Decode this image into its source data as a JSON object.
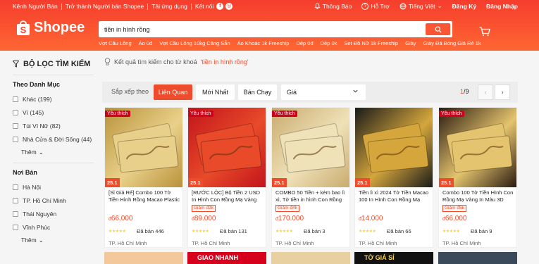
{
  "topbar": {
    "left": [
      "Kênh Người Bán",
      "Trở thành Người bán Shopee",
      "Tải ứng dụng",
      "Kết nối"
    ],
    "notifications": "Thông Báo",
    "help": "Hỗ Trợ",
    "language": "Tiếng Việt",
    "register": "Đăng Ký",
    "login": "Đăng Nhập"
  },
  "logo": {
    "text": "Shopee"
  },
  "search": {
    "query": "tiền in hình rồng",
    "suggestions": [
      "Vợt Cầu Lông",
      "Áo 0đ",
      "Vợt Cầu Lông 10kg Căng Sẵn",
      "Áo Khoác 1k Freeship",
      "Dép 0đ",
      "Dép 0k",
      "Set Đồ Nữ 1k Freeship",
      "Giày",
      "Giày Đá Bóng Giá Rẻ 1k"
    ]
  },
  "sidebar": {
    "title": "BỘ LỌC TÌM KIẾM",
    "category_title": "Theo Danh Mục",
    "categories": [
      "Khác (199)",
      "Ví (145)",
      "Túi Ví Nữ (82)",
      "Nhà Cửa & Đời Sống (44)"
    ],
    "more": "Thêm",
    "location_title": "Nơi Bán",
    "locations": [
      "Hà Nội",
      "TP. Hồ Chí Minh",
      "Thái Nguyên",
      "Vĩnh Phúc"
    ],
    "more2": "Thêm"
  },
  "result": {
    "prefix": "Kết quả tìm kiếm cho từ khoá",
    "keyword": "'tiền in hình rồng'"
  },
  "sort": {
    "label": "Sắp xếp theo",
    "relevant": "Liên Quan",
    "newest": "Mới Nhất",
    "top_sales": "Bán Chạy",
    "price": "Giá",
    "page_current": "1",
    "page_total": "/9"
  },
  "products": [
    {
      "badge": "Yêu thích",
      "sale": "25.1",
      "title": "[Sỉ Giá Rẻ] Combo 100 Tờ Tiền Hình Rồng Macao Plastic Mạ...",
      "discount": "",
      "currency": "đ",
      "price": "66.000",
      "sold": "Đã bán 446",
      "location": "TP. Hồ Chí Minh",
      "bg1": "#b8923a",
      "bg2": "#e9d08a"
    },
    {
      "badge": "Yêu thích",
      "sale": "25.1",
      "title": "[RƯỚC LỘC] Bộ Tiền 2 USD In Hình Con Rồng Mạ Vàng Mừ...",
      "discount": "Giảm đ2k",
      "currency": "đ",
      "price": "89.000",
      "sold": "Đã bán 131",
      "location": "TP. Hồ Chí Minh",
      "bg1": "#c2141b",
      "bg2": "#e84a2a"
    },
    {
      "badge": "Yêu thích",
      "sale": "25.1",
      "title": "COMBO 50 Tiền + kèm bao lì xì, Tờ tiền in hình Con Rồng Mạ...",
      "discount": "Giảm đ4k",
      "currency": "đ",
      "price": "170.000",
      "sold": "Đã bán 3",
      "location": "TP. Hồ Chí Minh",
      "bg1": "#c9ab6e",
      "bg2": "#efe1b8"
    },
    {
      "badge": "",
      "sale": "25.1",
      "title": "Tiền lì xì 2024 Tờ Tiền Macao 100 In Hình Con Rồng Mạ Vàn...",
      "discount": "",
      "currency": "đ",
      "price": "14.000",
      "sold": "Đã bán 66",
      "location": "TP. Hồ Chí Minh",
      "bg1": "#1a1a1a",
      "bg2": "#d4a63c"
    },
    {
      "badge": "Yêu thích",
      "sale": "25.1",
      "title": "Combo 100 Tờ Tiền Hình Con Rồng Mạ Vàng In Màu 3D Tài...",
      "discount": "Giảm đ5k",
      "currency": "đ",
      "price": "66.000",
      "sold": "Đã bán 9",
      "location": "TP. Hồ Chí Minh",
      "bg1": "#2a1a10",
      "bg2": "#e4c46e"
    }
  ],
  "next_row": [
    "",
    "GIAO NHANH",
    "",
    "TỜ GIÁ SỈ",
    "",
    "TỜ GIÁ SỈ"
  ],
  "colors": {
    "brand": "#ee4d2d",
    "header": "#f53d2d"
  }
}
